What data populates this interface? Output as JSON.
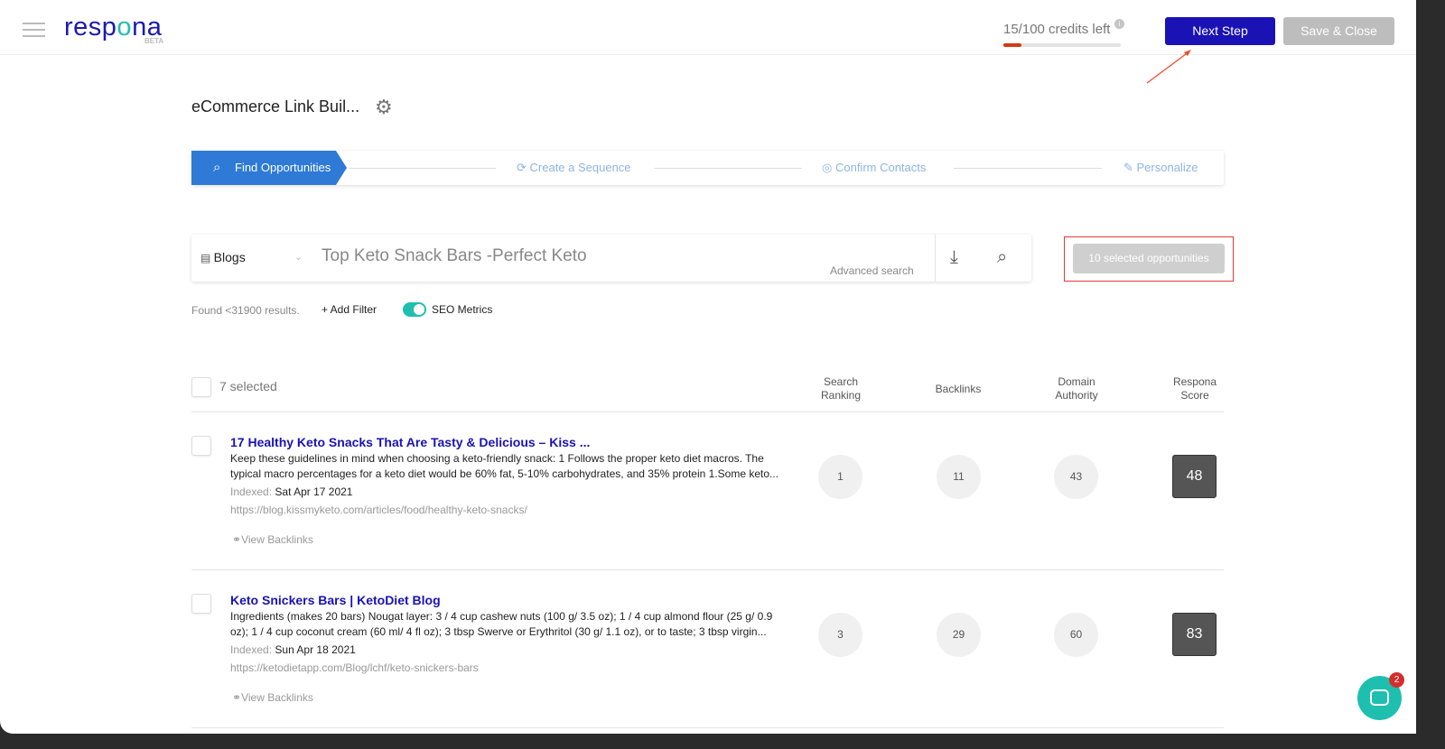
{
  "header": {
    "logo": "respona",
    "beta": "BETA",
    "credits": "15/100 credits left",
    "credits_fraction": 0.15,
    "next_step": "Next Step",
    "save_close": "Save & Close"
  },
  "campaign": {
    "title": "eCommerce Link Buil..."
  },
  "steps": [
    {
      "label": "Find Opportunities",
      "active": true
    },
    {
      "label": "Create a Sequence"
    },
    {
      "label": "Confirm Contacts"
    },
    {
      "label": "Personalize"
    }
  ],
  "search": {
    "source": "Blogs",
    "query": "Top Keto Snack Bars -Perfect Keto",
    "advanced": "Advanced search",
    "selected_opportunities": "10 selected opportunities"
  },
  "filters": {
    "found": "Found <31900 results.",
    "add_filter": "+ Add Filter",
    "seo_metrics": "SEO Metrics",
    "seo_on": true
  },
  "table": {
    "selected": "7 selected",
    "columns": [
      "Search\nRanking",
      "Backlinks",
      "Domain\nAuthority",
      "Respona\nScore"
    ],
    "rows": [
      {
        "title": "17 Healthy Keto Snacks That Are Tasty & Delicious – Kiss ...",
        "desc": "Keep these guidelines in mind when choosing a keto-friendly snack: 1 Follows the proper keto diet macros. The typical macro percentages for a keto diet would be 60% fat, 5-10% carbohydrates, and 35% protein 1.Some keto...",
        "indexed_label": "Indexed:",
        "indexed": "Sat Apr 17 2021",
        "url": "https://blog.kissmyketo.com/articles/food/healthy-keto-snacks/",
        "view": "View Backlinks",
        "ranking": "1",
        "backlinks": "11",
        "da": "43",
        "score": "48"
      },
      {
        "title": "Keto Snickers Bars | KetoDiet Blog",
        "desc": "Ingredients (makes 20 bars) Nougat layer: 3 / 4 cup cashew nuts (100 g/ 3.5 oz); 1 / 4 cup almond flour (25 g/ 0.9 oz); 1 / 4 cup coconut cream (60 ml/ 4 fl oz); 3 tbsp Swerve or Erythritol (30 g/ 1.1 oz), or to taste; 3 tbsp virgin...",
        "indexed_label": "Indexed:",
        "indexed": "Sun Apr 18 2021",
        "url": "https://ketodietapp.com/Blog/lchf/keto-snickers-bars",
        "view": "View Backlinks",
        "ranking": "3",
        "backlinks": "29",
        "da": "60",
        "score": "83"
      }
    ]
  },
  "chat": {
    "badge": "2"
  }
}
